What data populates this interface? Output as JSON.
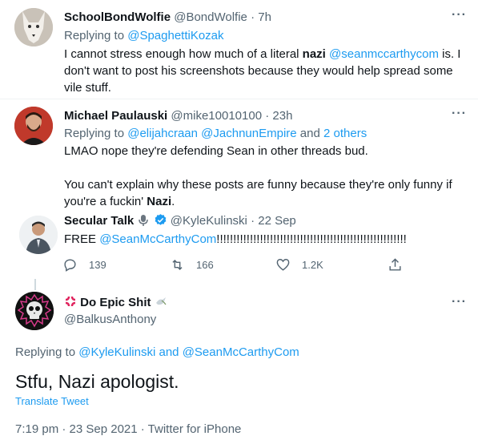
{
  "tweet1": {
    "name": "SchoolBondWolfie",
    "handle": "@BondWolfie",
    "time": "7h",
    "replying_prefix": "Replying to",
    "replying_to": "@SpaghettiKozak",
    "line1_a": "I cannot stress enough how much of a literal ",
    "line1_bold": "nazi",
    "line1_mention": "@seanmccarthycom",
    "line1_b": " is. I",
    "line2": "don't want to post his screenshots because they would help spread some",
    "line3": "vile stuff."
  },
  "tweet2": {
    "name": "Michael Paulauski",
    "handle": "@mike10010100",
    "time": "23h",
    "replying_prefix": "Replying to",
    "replying_to_1": "@elijahcraan",
    "replying_to_2": "@JachnunEmpire",
    "replying_and": "and",
    "replying_others": "2 others",
    "line1": "LMAO nope they're defending Sean in other threads bud.",
    "line2": "You can't explain why these posts are funny because they're only funny if",
    "line3_a": "you're a fuckin' ",
    "line3_bold": "Nazi",
    "line3_b": "."
  },
  "tweet3": {
    "name": "Secular Talk",
    "handle": "@KyleKulinski",
    "time": "22 Sep",
    "text_a": "FREE ",
    "mention": "@SeanMcCarthyCom",
    "text_b": "!!!!!!!!!!!!!!!!!!!!!!!!!!!!!!!!!!!!!!!!!!!!!!!!!!!!!!!!!",
    "replies": "139",
    "retweets": "166",
    "likes": "1.2K"
  },
  "main_tweet": {
    "name": "Do Epic Shit",
    "handle": "@BalkusAnthony",
    "replying_prefix": "Replying to",
    "replying_to_1": "@KyleKulinski",
    "replying_and": "and",
    "replying_to_2": "@SeanMcCarthyCom",
    "text": "Stfu, Nazi apologist.",
    "translate": "Translate Tweet",
    "timestamp": "7:19 pm · 23 Sep 2021 · Twitter for iPhone"
  },
  "colors": {
    "link": "#1d9bf0",
    "muted": "#536471",
    "text": "#0f1419",
    "verified": "#1d9bf0",
    "divider": "#eff3f4"
  },
  "icons": [
    "more-icon",
    "verified-icon",
    "microphone-icon",
    "anger-icon",
    "dove-icon",
    "reply-icon",
    "retweet-icon",
    "like-icon",
    "share-icon"
  ]
}
